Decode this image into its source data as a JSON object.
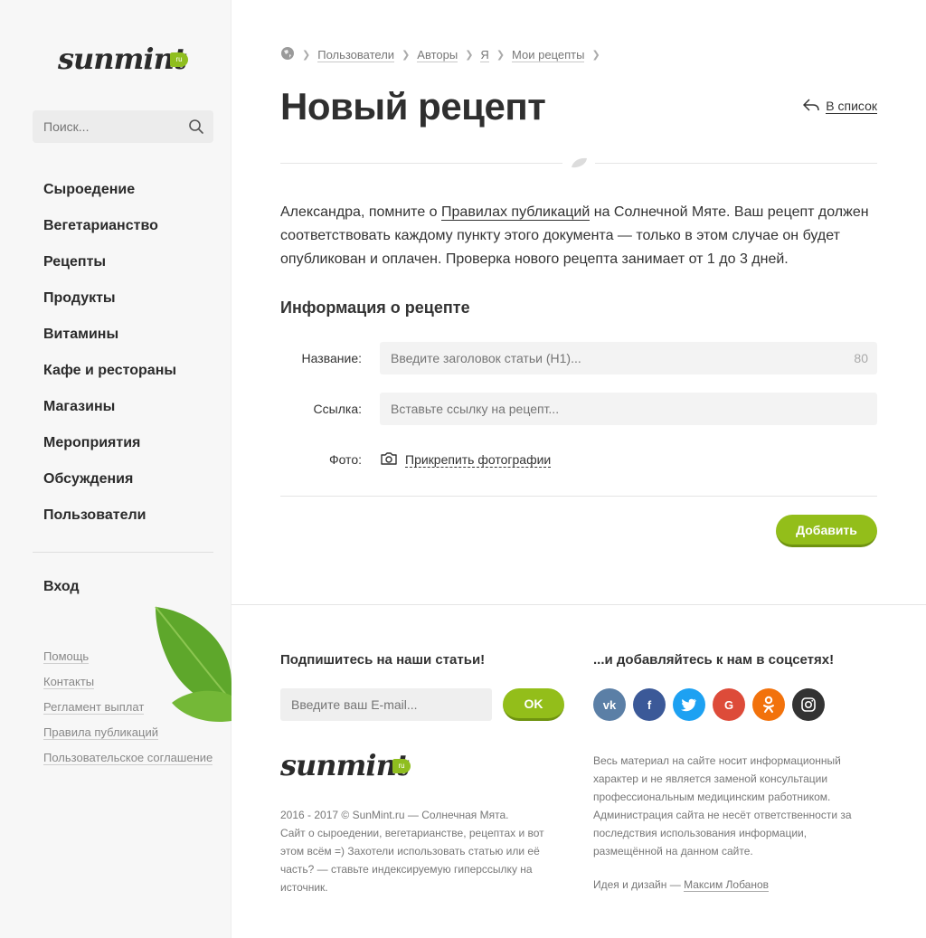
{
  "brand": {
    "logo_text": "sunmint",
    "logo_badge": "ru"
  },
  "sidebar": {
    "search_placeholder": "Поиск...",
    "menu": [
      "Сыроедение",
      "Вегетарианство",
      "Рецепты",
      "Продукты",
      "Витамины",
      "Кафе и рестораны",
      "Магазины",
      "Мероприятия",
      "Обсуждения",
      "Пользователи"
    ],
    "login": "Вход",
    "links": [
      "Помощь",
      "Контакты",
      "Регламент выплат",
      "Правила публикаций",
      "Пользовательское соглашение"
    ]
  },
  "breadcrumb": [
    "Пользователи",
    "Авторы",
    "Я",
    "Мои рецепты"
  ],
  "page": {
    "title": "Новый рецепт",
    "back_link": "В список",
    "intro_before": "Александра, помните о ",
    "intro_link": "Правилах публикаций",
    "intro_after": " на Солнечной Мяте. Ваш рецепт должен соответствовать каждому пункту этого документа — только в этом случае он будет опубликован и оплачен. Проверка нового рецепта занимает от 1 до 3 дней."
  },
  "form": {
    "section_title": "Информация о рецепте",
    "title_label": "Название:",
    "title_placeholder": "Введите заголовок статьи (H1)...",
    "title_counter": "80",
    "link_label": "Ссылка:",
    "link_placeholder": "Вставьте ссылку на рецепт...",
    "photo_label": "Фото:",
    "photo_attach": "Прикрепить фотографии",
    "submit": "Добавить"
  },
  "footer": {
    "subscribe_title": "Подпишитесь на наши статьи!",
    "email_placeholder": "Введите ваш E-mail...",
    "ok_button": "OK",
    "social_title": "...и добавляйтесь к нам в соцсетях!",
    "socials": [
      {
        "name": "vk",
        "glyph": "vk",
        "color": "#5b7fa6"
      },
      {
        "name": "facebook",
        "glyph": "f",
        "color": "#3b5998"
      },
      {
        "name": "twitter",
        "glyph": "t",
        "color": "#1da1f2"
      },
      {
        "name": "google",
        "glyph": "G",
        "color": "#dd4b39"
      },
      {
        "name": "odnoklassniki",
        "glyph": "ok",
        "color": "#f2720c"
      },
      {
        "name": "instagram",
        "glyph": "ig",
        "color": "#333333"
      }
    ],
    "copyright_line1": "2016 - 2017 © SunMint.ru — Солнечная Мята.",
    "copyright_line2": "Сайт о сыроедении, вегетарианстве, рецептах и вот этом всём =) Захотели использовать статью или её часть? — ставьте индексируемую гиперссылку на источник.",
    "disclaimer": "Весь материал на сайте носит информационный характер и не является заменой консультации профессиональным медицинским работником. Администрация сайта не несёт ответственности за последствия использования информации, размещённой на данном сайте.",
    "credit_prefix": "Идея и дизайн — ",
    "credit_author": "Максим Лобанов"
  }
}
